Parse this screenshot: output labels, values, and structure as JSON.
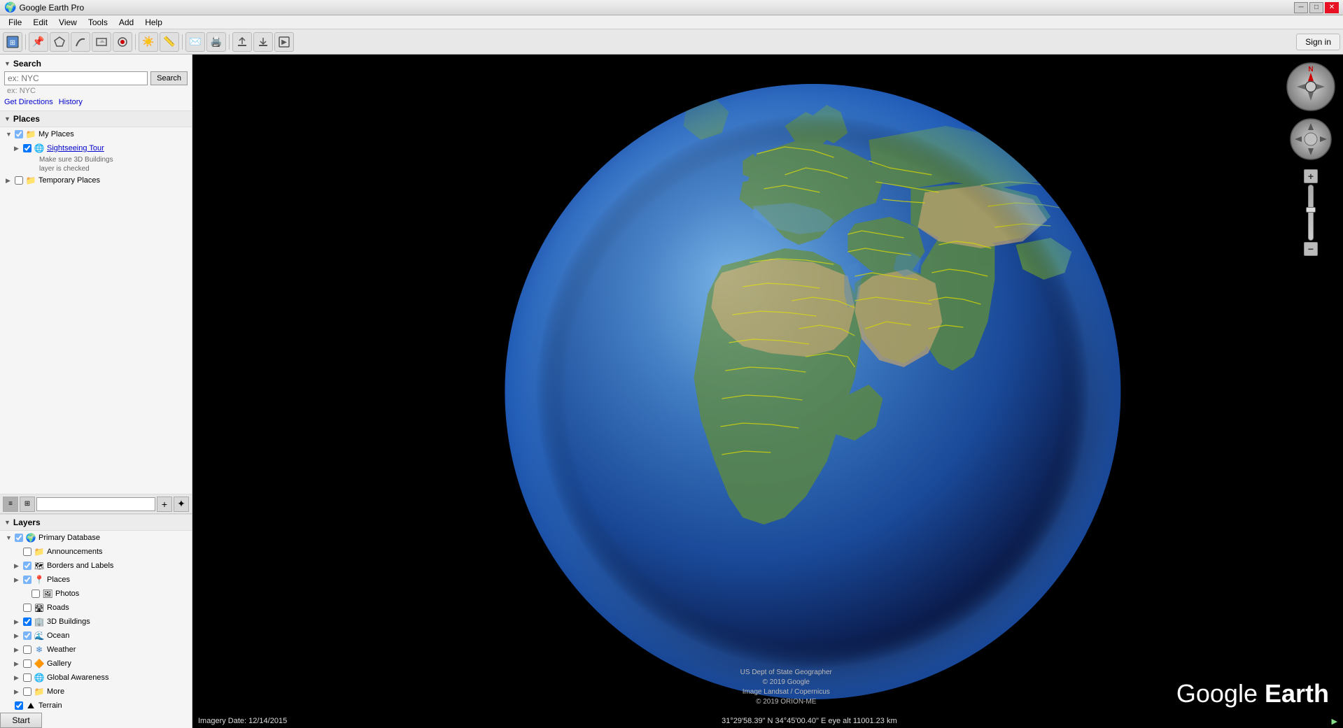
{
  "app": {
    "title": "Google Earth Pro",
    "icon": "🌍"
  },
  "titlebar": {
    "title": "Google Earth Pro",
    "minimize": "─",
    "maximize": "□",
    "close": "✕"
  },
  "menubar": {
    "items": [
      "File",
      "Edit",
      "View",
      "Tools",
      "Add",
      "Help"
    ]
  },
  "toolbar": {
    "buttons": [
      {
        "name": "earth-view",
        "icon": "⬛"
      },
      {
        "name": "placemark",
        "icon": "📌"
      },
      {
        "name": "polygon",
        "icon": "⬡"
      },
      {
        "name": "path",
        "icon": "〰"
      },
      {
        "name": "image-overlay",
        "icon": "🖼"
      },
      {
        "name": "record-tour",
        "icon": "⏺"
      },
      {
        "name": "sun",
        "icon": "☀"
      },
      {
        "name": "ruler",
        "icon": "📏"
      },
      {
        "name": "email",
        "icon": "✉"
      },
      {
        "name": "print",
        "icon": "🖨"
      },
      {
        "name": "upload",
        "icon": "⬆"
      },
      {
        "name": "download",
        "icon": "⬇"
      },
      {
        "name": "import",
        "icon": "📥"
      }
    ],
    "signin_label": "Sign in"
  },
  "search": {
    "label": "Search",
    "placeholder": "ex: NYC",
    "button_label": "Search",
    "get_directions": "Get Directions",
    "history": "History"
  },
  "places": {
    "label": "Places",
    "items": [
      {
        "id": "my-places",
        "text": "My Places",
        "level": 1,
        "type": "folder",
        "expanded": true,
        "checked": true,
        "indeterminate": true
      },
      {
        "id": "sightseeing-tour",
        "text": "Sightseeing Tour",
        "level": 2,
        "type": "link",
        "expanded": false,
        "checked": true,
        "indeterminate": false
      },
      {
        "id": "hint1",
        "text": "Make sure 3D Buildings",
        "level": "hint"
      },
      {
        "id": "hint2",
        "text": "layer is checked",
        "level": "hint"
      },
      {
        "id": "temporary-places",
        "text": "Temporary Places",
        "level": 1,
        "type": "folder",
        "expanded": false,
        "checked": false,
        "indeterminate": false
      }
    ]
  },
  "layers": {
    "label": "Layers",
    "items": [
      {
        "id": "primary-db",
        "text": "Primary Database",
        "level": 1,
        "type": "globe",
        "expanded": true,
        "checked": true,
        "indeterminate": true
      },
      {
        "id": "announcements",
        "text": "Announcements",
        "level": 2,
        "type": "folder",
        "checked": false
      },
      {
        "id": "borders-labels",
        "text": "Borders and Labels",
        "level": 2,
        "type": "borders",
        "checked": true,
        "indeterminate": true
      },
      {
        "id": "places",
        "text": "Places",
        "level": 2,
        "type": "pin",
        "checked": true,
        "indeterminate": true
      },
      {
        "id": "photos",
        "text": "Photos",
        "level": 3,
        "type": "photo",
        "checked": false
      },
      {
        "id": "roads",
        "text": "Roads",
        "level": 2,
        "type": "road",
        "checked": false
      },
      {
        "id": "3d-buildings",
        "text": "3D Buildings",
        "level": 2,
        "type": "building",
        "checked": true,
        "indeterminate": false
      },
      {
        "id": "ocean",
        "text": "Ocean",
        "level": 2,
        "type": "water",
        "checked": true,
        "indeterminate": true
      },
      {
        "id": "weather",
        "text": "Weather",
        "level": 2,
        "type": "weather",
        "checked": false,
        "indeterminate": false
      },
      {
        "id": "gallery",
        "text": "Gallery",
        "level": 2,
        "type": "gallery",
        "checked": false
      },
      {
        "id": "global-awareness",
        "text": "Global Awareness",
        "level": 2,
        "type": "globe",
        "checked": false
      },
      {
        "id": "more",
        "text": "More",
        "level": 2,
        "type": "folder",
        "checked": false
      },
      {
        "id": "terrain",
        "text": "Terrain",
        "level": 1,
        "type": "terrain",
        "checked": true
      }
    ]
  },
  "statusbar": {
    "imagery_date": "Imagery Date: 12/14/2015",
    "coordinates": "31°29'58.39\" N  34°45'00.40\" E  eye alt 11001.23 km",
    "streaming": "▶"
  },
  "watermark": {
    "text_plain": "Google ",
    "text_bold": "Earth"
  },
  "attribution": {
    "line1": "US Dept of State Geographer",
    "line2": "© 2019 Google",
    "line3": "Image Landsat / Copernicus",
    "line4": "© 2019 ORION-ME"
  },
  "nav": {
    "compass_n": "N",
    "zoom_plus": "+",
    "zoom_minus": "−"
  },
  "start_button": "Start"
}
